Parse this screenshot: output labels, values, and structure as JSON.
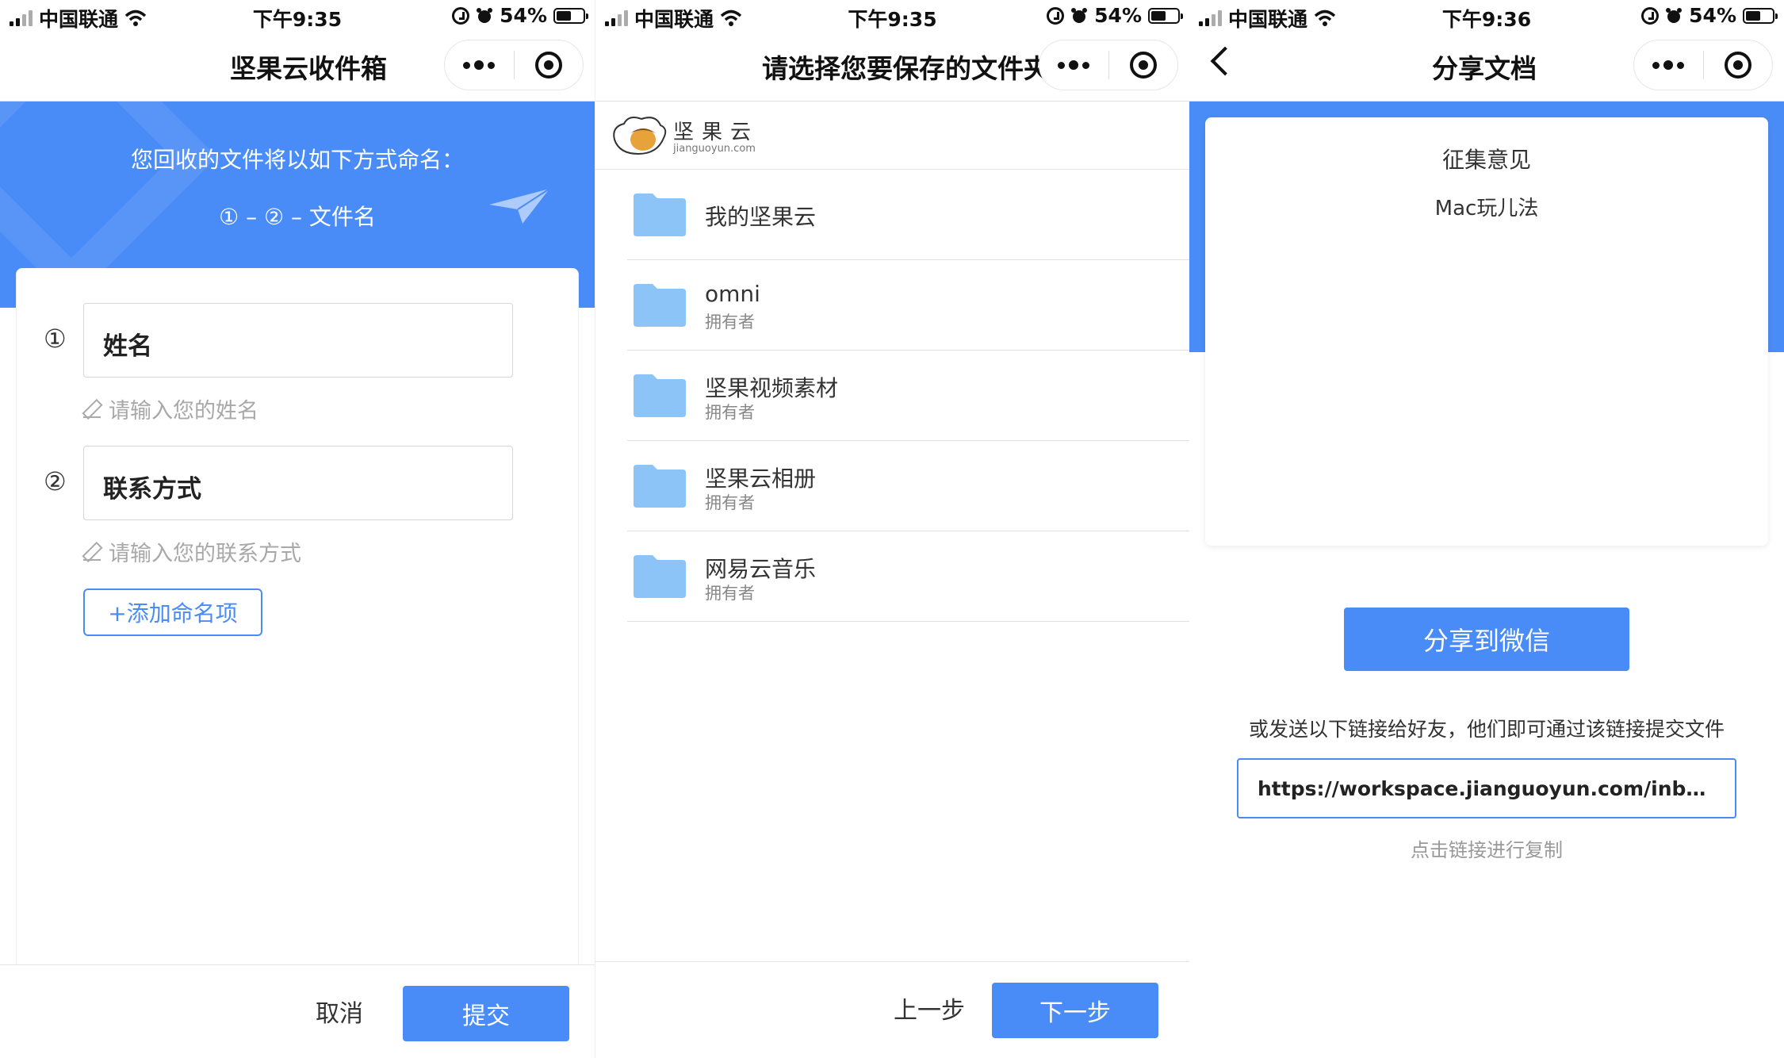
{
  "status_bars": [
    {
      "carrier": "中国联通",
      "time": "下午9:35",
      "battery": "54%"
    },
    {
      "carrier": "中国联通",
      "time": "下午9:35",
      "battery": "54%"
    },
    {
      "carrier": "中国联通",
      "time": "下午9:36",
      "battery": "54%"
    }
  ],
  "panel1": {
    "title": "坚果云收件箱",
    "hero_line1": "您回收的文件将以如下方式命名：",
    "hero_line2": "① – ② – 文件名",
    "fields": [
      {
        "num": "①",
        "label": "姓名",
        "hint": "请输入您的姓名"
      },
      {
        "num": "②",
        "label": "联系方式",
        "hint": "请输入您的联系方式"
      }
    ],
    "add_label": "+添加命名项",
    "cancel": "取消",
    "submit": "提交"
  },
  "panel2": {
    "title": "请选择您要保存的文件夹",
    "logo_text": "坚果云",
    "logo_sub": "jianguoyun.com",
    "folders": [
      {
        "name": "我的坚果云",
        "sub": ""
      },
      {
        "name": "omni",
        "sub": "拥有者"
      },
      {
        "name": "坚果视频素材",
        "sub": "拥有者"
      },
      {
        "name": "坚果云相册",
        "sub": "拥有者"
      },
      {
        "name": "网易云音乐",
        "sub": "拥有者"
      }
    ],
    "prev": "上一步",
    "next": "下一步"
  },
  "panel3": {
    "title": "分享文档",
    "card_title": "征集意见",
    "card_sub": "Mac玩儿法",
    "share_button": "分享到微信",
    "desc": "或发送以下链接给好友，他们即可通过该链接提交文件",
    "link": "https://workspace.jianguoyun.com/inbo...",
    "copy_hint": "点击链接进行复制"
  },
  "colors": {
    "accent": "#4a8cf7",
    "folder": "#8cc4f8"
  },
  "icons": [
    "signal-icon",
    "wifi-icon",
    "lock-rotation-icon",
    "alarm-icon",
    "battery-icon",
    "more-icon",
    "target-icon",
    "back-icon",
    "pencil-icon",
    "folder-icon",
    "paper-plane-icon",
    "acorn-logo-icon"
  ]
}
